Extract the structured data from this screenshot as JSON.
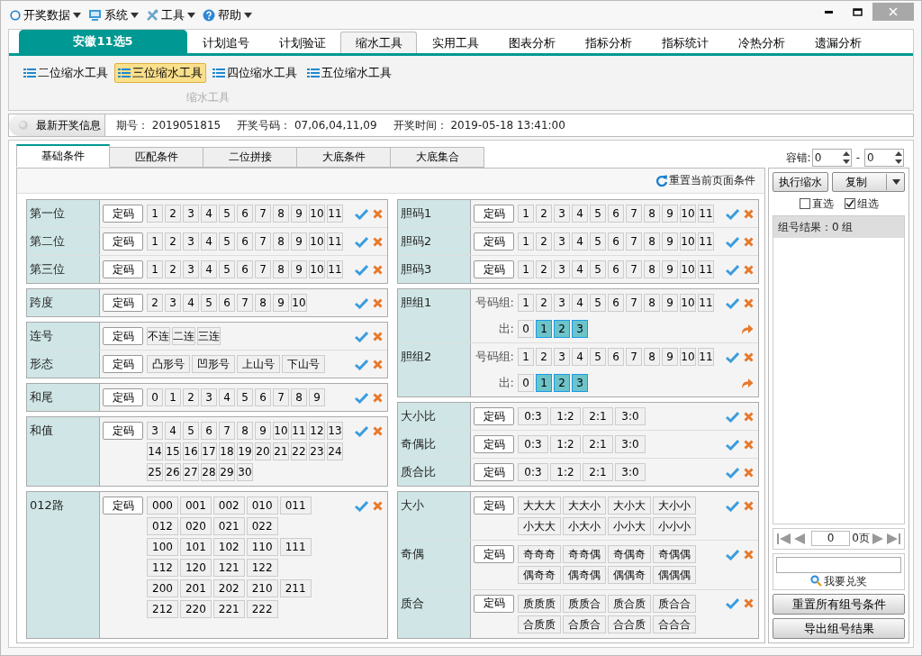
{
  "menu": [
    {
      "label": "开奖数据",
      "kind": "data"
    },
    {
      "label": "系统",
      "kind": "system"
    },
    {
      "label": "工具",
      "kind": "tools"
    },
    {
      "label": "帮助",
      "kind": "help"
    }
  ],
  "lottery": "安徽11选5",
  "main_tabs": [
    {
      "label": "计划追号",
      "selected": false
    },
    {
      "label": "计划验证",
      "selected": false
    },
    {
      "label": "缩水工具",
      "selected": true
    },
    {
      "label": "实用工具",
      "selected": false
    },
    {
      "label": "图表分析",
      "selected": false
    },
    {
      "label": "指标分析",
      "selected": false
    },
    {
      "label": "指标统计",
      "selected": false
    },
    {
      "label": "冷热分析",
      "selected": false
    },
    {
      "label": "遗漏分析",
      "selected": false
    }
  ],
  "ribbon": {
    "tools": [
      {
        "label": "二位缩水工具",
        "selected": false
      },
      {
        "label": "三位缩水工具",
        "selected": true
      },
      {
        "label": "四位缩水工具",
        "selected": false
      },
      {
        "label": "五位缩水工具",
        "selected": false
      }
    ],
    "group_label": "缩水工具"
  },
  "info": {
    "button": "最新开奖信息",
    "fields": [
      {
        "label": "期号：",
        "value": "2019051815"
      },
      {
        "label": "开奖号码：",
        "value": "07,06,04,11,09"
      },
      {
        "label": "开奖时间：",
        "value": "2019-05-18 13:41:00"
      }
    ]
  },
  "sub_tabs": [
    {
      "label": "基础条件",
      "selected": true
    },
    {
      "label": "匹配条件",
      "selected": false
    },
    {
      "label": "二位拼接",
      "selected": false
    },
    {
      "label": "大底条件",
      "selected": false
    },
    {
      "label": "大底集合",
      "selected": false
    }
  ],
  "reset_page": "重置当前页面条件",
  "columns": [
    [
      {
        "rows": [
          {
            "label": "第一位",
            "kind": "fixed",
            "fix": "定码",
            "lines": [
              [
                "1",
                "2",
                "3",
                "4",
                "5",
                "6",
                "7",
                "8",
                "9",
                "10",
                "11"
              ]
            ]
          },
          {
            "label": "第二位",
            "kind": "fixed",
            "fix": "定码",
            "lines": [
              [
                "1",
                "2",
                "3",
                "4",
                "5",
                "6",
                "7",
                "8",
                "9",
                "10",
                "11"
              ]
            ]
          },
          {
            "label": "第三位",
            "kind": "fixed",
            "fix": "定码",
            "lines": [
              [
                "1",
                "2",
                "3",
                "4",
                "5",
                "6",
                "7",
                "8",
                "9",
                "10",
                "11"
              ]
            ]
          }
        ]
      },
      {
        "rows": [
          {
            "label": "跨度",
            "kind": "fixed",
            "fix": "定码",
            "lines": [
              [
                "2",
                "3",
                "4",
                "5",
                "6",
                "7",
                "8",
                "9",
                "10"
              ]
            ]
          }
        ]
      },
      {
        "rows": [
          {
            "label": "连号",
            "kind": "fixed",
            "fix": "定码",
            "lines": [
              [
                "不连",
                "二连",
                "三连"
              ]
            ]
          },
          {
            "label": "形态",
            "kind": "fixed",
            "fix": "定码",
            "lines": [
              [
                "凸形号",
                "凹形号",
                "上山号",
                "下山号"
              ]
            ]
          }
        ]
      },
      {
        "rows": [
          {
            "label": "和尾",
            "kind": "fixed",
            "fix": "定码",
            "lines": [
              [
                "0",
                "1",
                "2",
                "3",
                "4",
                "5",
                "6",
                "7",
                "8",
                "9"
              ]
            ]
          }
        ]
      },
      {
        "rows": [
          {
            "label": "和值",
            "kind": "fixed",
            "fix": "定码",
            "lines": [
              [
                "3",
                "4",
                "5",
                "6",
                "7",
                "8",
                "9",
                "10",
                "11",
                "12",
                "13"
              ],
              [
                "14",
                "15",
                "16",
                "17",
                "18",
                "19",
                "20",
                "21",
                "22",
                "23",
                "24"
              ],
              [
                "25",
                "26",
                "27",
                "28",
                "29",
                "30"
              ]
            ]
          }
        ]
      },
      {
        "rows": [
          {
            "label": "012路",
            "kind": "fixed",
            "fix": "定码",
            "lines": [
              [
                "000",
                "001",
                "002",
                "010",
                "011"
              ],
              [
                "012",
                "020",
                "021",
                "022"
              ],
              [
                "100",
                "101",
                "102",
                "110",
                "111"
              ],
              [
                "112",
                "120",
                "121",
                "122"
              ],
              [
                "200",
                "201",
                "202",
                "210",
                "211"
              ],
              [
                "212",
                "220",
                "221",
                "222"
              ]
            ]
          }
        ]
      }
    ],
    [
      {
        "rows": [
          {
            "label": "胆码1",
            "kind": "fixed",
            "fix": "定码",
            "lines": [
              [
                "1",
                "2",
                "3",
                "4",
                "5",
                "6",
                "7",
                "8",
                "9",
                "10",
                "11"
              ]
            ]
          },
          {
            "label": "胆码2",
            "kind": "fixed",
            "fix": "定码",
            "lines": [
              [
                "1",
                "2",
                "3",
                "4",
                "5",
                "6",
                "7",
                "8",
                "9",
                "10",
                "11"
              ]
            ]
          },
          {
            "label": "胆码3",
            "kind": "fixed",
            "fix": "定码",
            "lines": [
              [
                "1",
                "2",
                "3",
                "4",
                "5",
                "6",
                "7",
                "8",
                "9",
                "10",
                "11"
              ]
            ]
          }
        ]
      },
      {
        "rows": [
          {
            "label": "胆组1",
            "kind": "combo",
            "code_label": "号码组:",
            "lines": [
              [
                "1",
                "2",
                "3",
                "4",
                "5",
                "6",
                "7",
                "8",
                "9",
                "10",
                "11"
              ]
            ],
            "out_label": "出:",
            "out": [
              {
                "label": "0",
                "selected": false
              },
              {
                "label": "1",
                "selected": true
              },
              {
                "label": "2",
                "selected": true
              },
              {
                "label": "3",
                "selected": true
              }
            ]
          },
          {
            "label": "胆组2",
            "kind": "combo",
            "code_label": "号码组:",
            "lines": [
              [
                "1",
                "2",
                "3",
                "4",
                "5",
                "6",
                "7",
                "8",
                "9",
                "10",
                "11"
              ]
            ],
            "out_label": "出:",
            "out": [
              {
                "label": "0",
                "selected": false
              },
              {
                "label": "1",
                "selected": true
              },
              {
                "label": "2",
                "selected": true
              },
              {
                "label": "3",
                "selected": true
              }
            ]
          }
        ]
      },
      {
        "rows": [
          {
            "label": "大小比",
            "kind": "fixed",
            "fix": "定码",
            "lines": [
              [
                "0:3",
                "1:2",
                "2:1",
                "3:0"
              ]
            ]
          },
          {
            "label": "奇偶比",
            "kind": "fixed",
            "fix": "定码",
            "lines": [
              [
                "0:3",
                "1:2",
                "2:1",
                "3:0"
              ]
            ]
          },
          {
            "label": "质合比",
            "kind": "fixed",
            "fix": "定码",
            "lines": [
              [
                "0:3",
                "1:2",
                "2:1",
                "3:0"
              ]
            ]
          }
        ]
      },
      {
        "rows": [
          {
            "label": "大小",
            "kind": "fixed",
            "fix": "定码",
            "lines": [
              [
                "大大大",
                "大大小",
                "大小大",
                "大小小"
              ],
              [
                "小大大",
                "小大小",
                "小小大",
                "小小小"
              ]
            ]
          },
          {
            "label": "奇偶",
            "kind": "fixed",
            "fix": "定码",
            "lines": [
              [
                "奇奇奇",
                "奇奇偶",
                "奇偶奇",
                "奇偶偶"
              ],
              [
                "偶奇奇",
                "偶奇偶",
                "偶偶奇",
                "偶偶偶"
              ]
            ]
          },
          {
            "label": "质合",
            "kind": "fixed",
            "fix": "定码",
            "lines": [
              [
                "质质质",
                "质质合",
                "质合质",
                "质合合"
              ],
              [
                "合质质",
                "合质合",
                "合合质",
                "合合合"
              ]
            ]
          }
        ]
      }
    ]
  ],
  "side": {
    "tolerance": {
      "label": "容错:",
      "from": "0",
      "separator": "-",
      "to": "0"
    },
    "run": "执行缩水",
    "copy": "复制",
    "checks": [
      {
        "label": "直选",
        "checked": false
      },
      {
        "label": "组选",
        "checked": true
      }
    ],
    "result_header": "组号结果：0 组",
    "pager": {
      "page": "0",
      "pages": "0页"
    },
    "redeem": "我要兑奖",
    "buttons": [
      "重置所有组号条件",
      "导出组号结果"
    ]
  }
}
